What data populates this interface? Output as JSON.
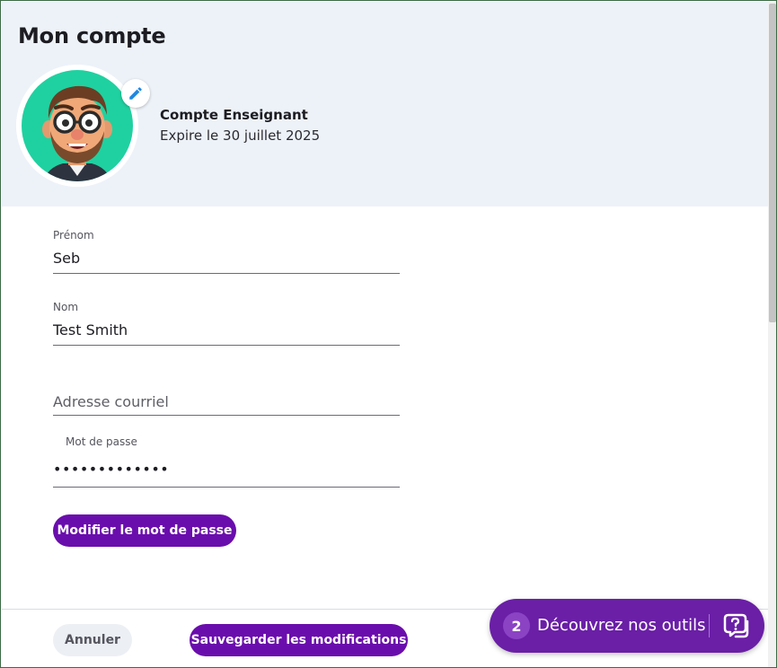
{
  "header": {
    "title": "Mon compte",
    "account_type": "Compte Enseignant",
    "expiry": "Expire le 30 juillet 2025"
  },
  "form": {
    "first_name": {
      "label": "Prénom",
      "value": "Seb"
    },
    "last_name": {
      "label": "Nom",
      "value": "Test Smith"
    },
    "email": {
      "placeholder": "Adresse courriel",
      "value": ""
    },
    "password": {
      "label": "Mot de passe",
      "value": "•••••••••••••"
    },
    "change_password_label": "Modifier le mot de passe"
  },
  "footer": {
    "cancel_label": "Annuler",
    "save_label": "Sauvegarder les modifications"
  },
  "discover": {
    "count": "2",
    "label": "Découvrez nos outils"
  },
  "colors": {
    "primary": "#6a0dad",
    "header_bg": "#edf2f9",
    "avatar_ring": "#1fd1a0",
    "edit_icon": "#1e88e5"
  },
  "icons": [
    "pencil-icon",
    "avatar-illustration",
    "help-chat-icon"
  ]
}
